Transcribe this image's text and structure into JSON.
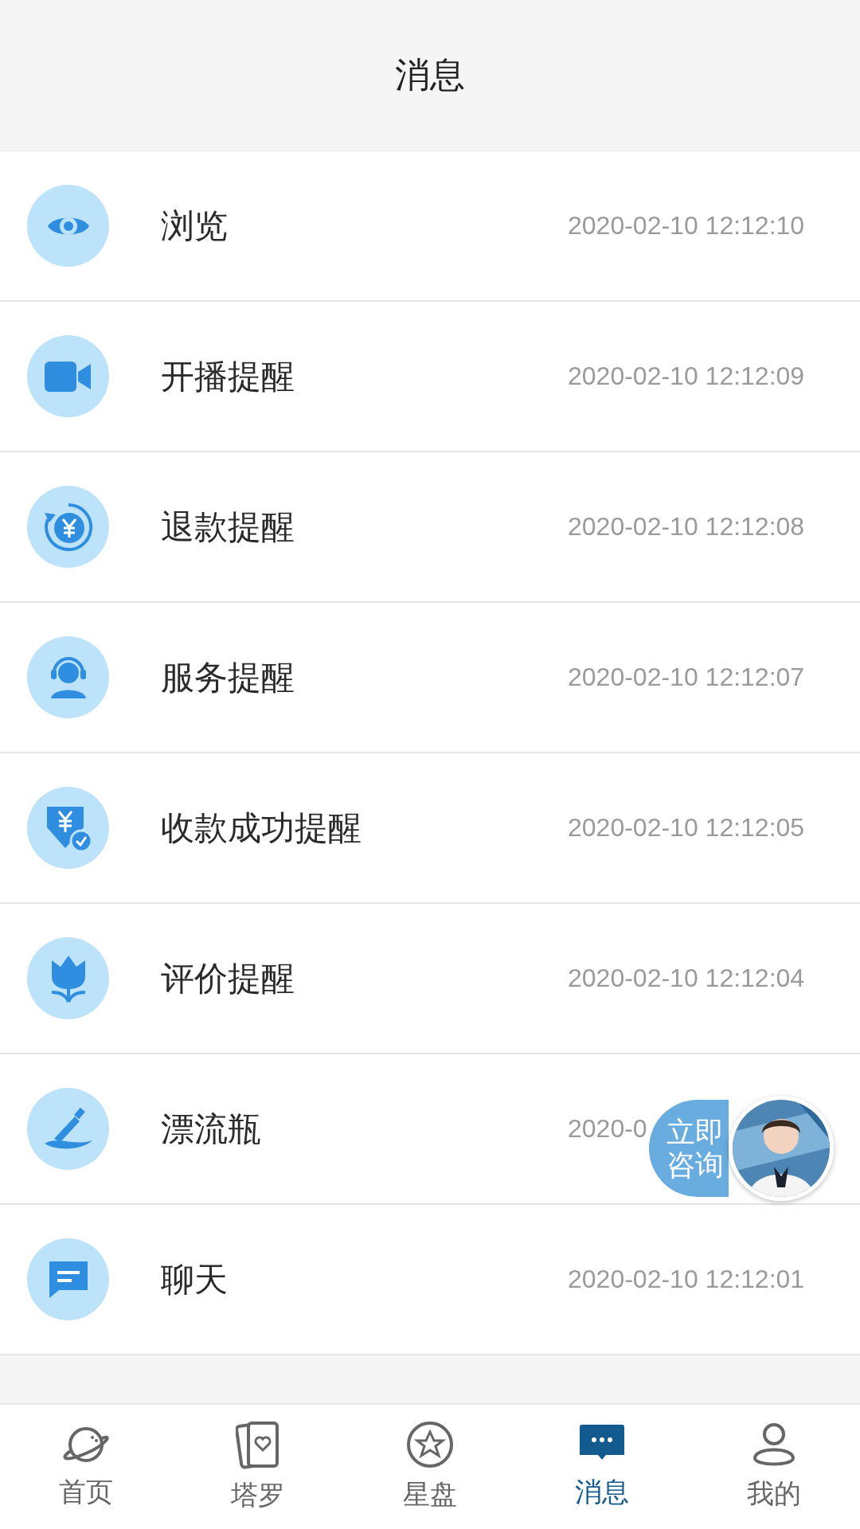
{
  "header": {
    "title": "消息"
  },
  "messages": [
    {
      "title": "浏览",
      "time": "2020-02-10 12:12:10"
    },
    {
      "title": "开播提醒",
      "time": "2020-02-10 12:12:09"
    },
    {
      "title": "退款提醒",
      "time": "2020-02-10 12:12:08"
    },
    {
      "title": "服务提醒",
      "time": "2020-02-10 12:12:07"
    },
    {
      "title": "收款成功提醒",
      "time": "2020-02-10 12:12:05"
    },
    {
      "title": "评价提醒",
      "time": "2020-02-10 12:12:04"
    },
    {
      "title": "漂流瓶",
      "time": "2020-0"
    },
    {
      "title": "聊天",
      "time": "2020-02-10 12:12:01"
    }
  ],
  "consult_button": {
    "label": "立即咨询"
  },
  "tab_bar": [
    {
      "label": "首页",
      "selected": false
    },
    {
      "label": "塔罗",
      "selected": false
    },
    {
      "label": "星盘",
      "selected": false
    },
    {
      "label": "消息",
      "selected": true
    },
    {
      "label": "我的",
      "selected": false
    }
  ]
}
